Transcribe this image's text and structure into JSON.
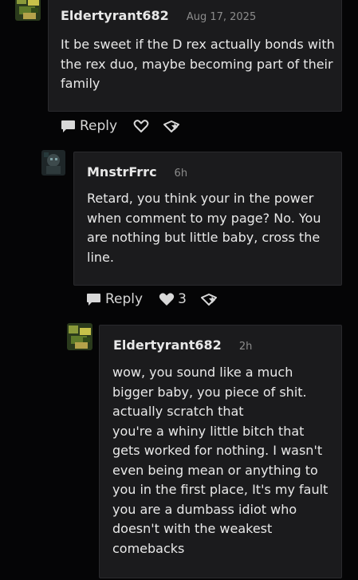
{
  "comments": [
    {
      "username": "Eldertyrant682",
      "time": "Aug 17, 2025",
      "lines": [
        "It be sweet if the D rex actually bonds with",
        "the rex duo, maybe becoming part of their",
        "family"
      ],
      "reply_label": "Reply",
      "like_count": ""
    },
    {
      "username": "MnstrFrrc",
      "time": "6h",
      "lines": [
        "Retard, you think your in the power",
        "when comment to my page? No. You",
        "are nothing but little baby, cross the",
        "line."
      ],
      "reply_label": "Reply",
      "like_count": "3"
    },
    {
      "username": "Eldertyrant682",
      "time": "2h",
      "lines": [
        "wow, you sound like a much",
        "bigger baby, you piece of shit.",
        "actually scratch that",
        "you're a whiny little bitch that",
        "gets worked for nothing. I wasn't",
        "even being mean or anything to",
        "you in the first place, It's my fault",
        "you are a dumbass idiot who",
        "doesn't with the weakest",
        "comebacks"
      ]
    }
  ]
}
